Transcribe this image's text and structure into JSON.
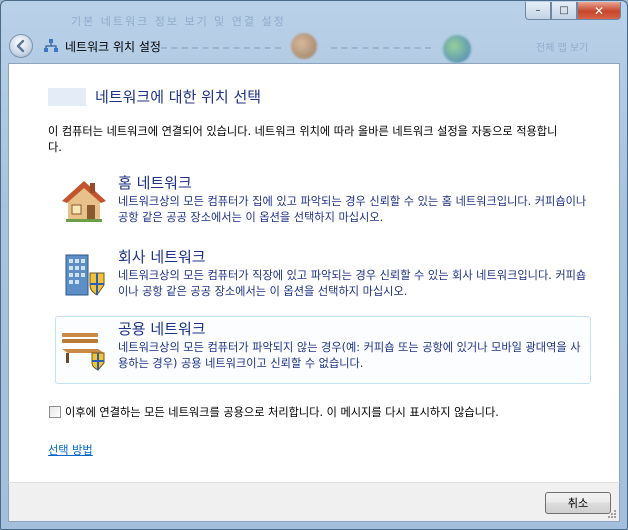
{
  "window": {
    "background_title": "기본 네트워크 정보 보기 및 연결 설정",
    "background_side": "전체 맵 보기",
    "caption": {
      "minimize": "–",
      "maximize": "□",
      "close": "✕"
    }
  },
  "nav": {
    "title": "네트워크 위치 설정",
    "back_icon": "back-arrow-icon",
    "title_icon": "network-icon"
  },
  "main": {
    "heading": "네트워크에 대한 위치 선택",
    "intro": "이 컴퓨터는 네트워크에 연결되어 있습니다. 네트워크 위치에 따라 올바른 네트워크 설정을 자동으로 적용합니다.",
    "options": [
      {
        "title": "홈 네트워크",
        "desc": "네트워크상의 모든 컴퓨터가 집에 있고 파악되는 경우 신뢰할 수 있는 홈 네트워크입니다. 커피숍이나 공항 같은 공공 장소에서는 이 옵션을 선택하지 마십시오.",
        "icon": "house-icon"
      },
      {
        "title": "회사 네트워크",
        "desc": "네트워크상의 모든 컴퓨터가 직장에 있고 파악되는 경우 신뢰할 수 있는 회사 네트워크입니다. 커피숍이나 공항 같은 공공 장소에서는 이 옵션을 선택하지 마십시오.",
        "icon": "office-building-icon"
      },
      {
        "title": "공용 네트워크",
        "desc": "네트워크상의 모든 컴퓨터가 파악되지 않는 경우(예: 커피숍 또는 공항에 있거나 모바일 광대역을 사용하는 경우) 공용 네트워크이고 신뢰할 수 없습니다.",
        "icon": "park-bench-icon"
      }
    ],
    "checkbox_label": "이후에 연결하는 모든 네트워크를 공용으로 처리합니다. 이 메시지를 다시 표시하지 않습니다.",
    "checkbox_checked": false,
    "help_link": "선택 방법"
  },
  "footer": {
    "cancel_label": "취소"
  },
  "colors": {
    "heading": "#1e3287",
    "link": "#0066cc",
    "close_button": "#c7452a"
  }
}
